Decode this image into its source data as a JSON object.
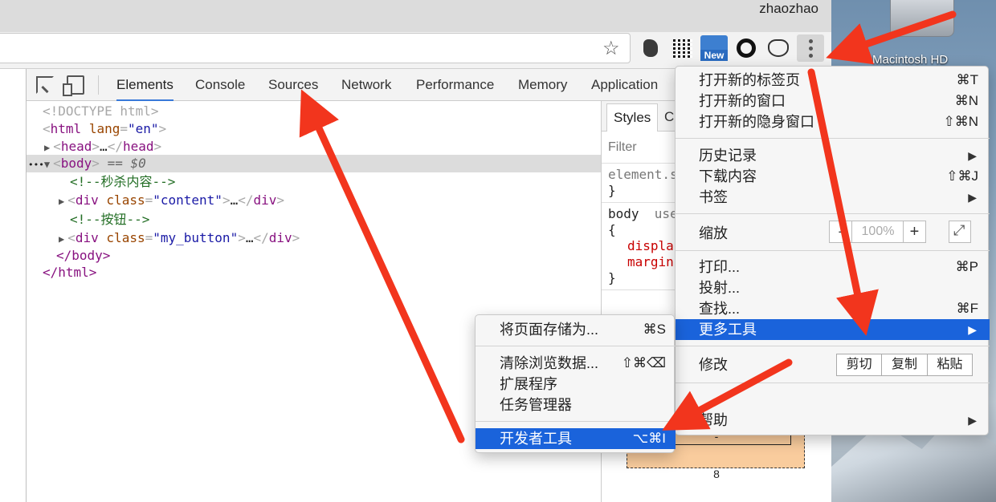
{
  "colors": {
    "accent": "#1a63db",
    "annotation_arrow": "#f2351d",
    "dom_tag": "#881280",
    "dom_attr": "#994500",
    "dom_value": "#1a1aa6",
    "dom_comment": "#236e25"
  },
  "titlebar": {
    "user": "zhaozhao"
  },
  "toolbar": {
    "star_icon": "☆",
    "ext_new_label": "New"
  },
  "desktop": {
    "drive_label": "Macintosh HD"
  },
  "devtools": {
    "tabs": [
      "Elements",
      "Console",
      "Sources",
      "Network",
      "Performance",
      "Memory",
      "Application"
    ],
    "active_tab": "Elements",
    "dom": {
      "l1": "<!DOCTYPE html>",
      "html_open": "html",
      "lang_attr": "lang",
      "lang_val": "\"en\"",
      "head": "head",
      "body_marker": "== $0",
      "comment1": "<!--秒杀内容-->",
      "class_attr": "class",
      "div1_val": "\"content\"",
      "comment2": "<!--按钮-->",
      "div2_val": "\"my_button\"",
      "body_close": "</body>",
      "html_close": "</html>",
      "ellipsis": "…",
      "dots": "•••"
    },
    "styles": {
      "tab_active": "Styles",
      "tab_second": "Co",
      "filter_placeholder": "Filter",
      "rule1_selector": "element.s",
      "rule1_close": "}",
      "rule2_selector": "body",
      "rule2_origin": "use",
      "rule2_open": "{",
      "rule2_prop1": "displa",
      "rule2_prop2": "margin",
      "rule2_close": "}",
      "boxmodel_inner": "-",
      "boxmodel_value": "8"
    }
  },
  "main_menu": {
    "new_tab": {
      "label": "打开新的标签页",
      "shortcut": "⌘T"
    },
    "new_window": {
      "label": "打开新的窗口",
      "shortcut": "⌘N"
    },
    "new_incognito": {
      "label": "打开新的隐身窗口",
      "shortcut": "⇧⌘N"
    },
    "history": {
      "label": "历史记录"
    },
    "downloads": {
      "label": "下载内容",
      "shortcut": "⇧⌘J"
    },
    "bookmarks": {
      "label": "书签"
    },
    "zoom": {
      "label": "缩放",
      "minus": "-",
      "value": "100%",
      "plus": "+"
    },
    "print": {
      "label": "打印...",
      "shortcut": "⌘P"
    },
    "cast": {
      "label": "投射..."
    },
    "find": {
      "label": "查找...",
      "shortcut": "⌘F"
    },
    "more_tools": {
      "label": "更多工具"
    },
    "edit": {
      "label": "修改",
      "cut": "剪切",
      "copy": "复制",
      "paste": "粘贴"
    },
    "help": {
      "label": "帮助"
    },
    "submenu_arrow": "▶"
  },
  "sub_menu": {
    "save_page": {
      "label": "将页面存储为...",
      "shortcut": "⌘S"
    },
    "clear_data": {
      "label": "清除浏览数据...",
      "shortcut": "⇧⌘⌫"
    },
    "extensions": {
      "label": "扩展程序"
    },
    "task_manager": {
      "label": "任务管理器"
    },
    "dev_tools": {
      "label": "开发者工具",
      "shortcut": "⌥⌘I"
    }
  }
}
